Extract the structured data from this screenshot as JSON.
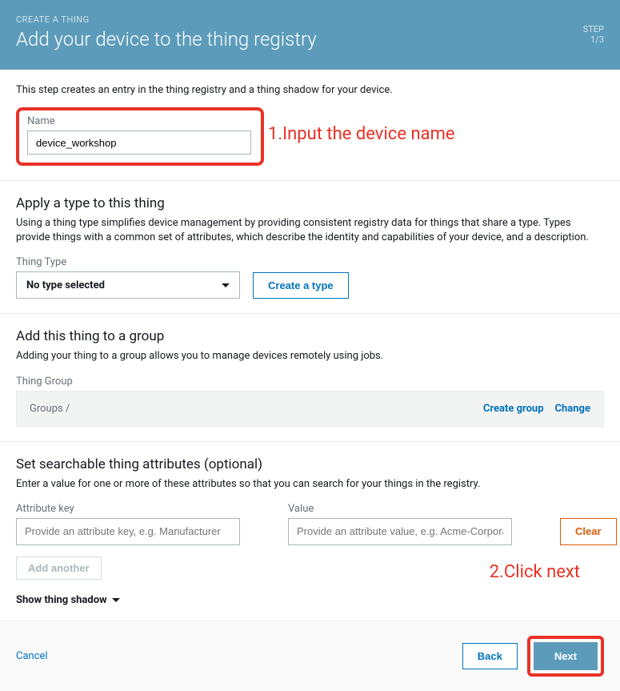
{
  "header": {
    "breadcrumb": "CREATE A THING",
    "title": "Add your device to the thing registry",
    "step_label": "STEP",
    "step_value": "1/3"
  },
  "intro": "This step creates an entry in the thing registry and a thing shadow for your device.",
  "name_field": {
    "label": "Name",
    "value": "device_workshop"
  },
  "annotations": {
    "a1": "1.Input the device name",
    "a2": "2.Click next"
  },
  "type_section": {
    "title": "Apply a type to this thing",
    "desc": "Using a thing type simplifies device management by providing consistent registry data for things that share a type. Types provide things with a common set of attributes, which describe the identity and capabilities of your device, and a description.",
    "label": "Thing Type",
    "selected": "No type selected",
    "create_btn": "Create a type"
  },
  "group_section": {
    "title": "Add this thing to a group",
    "desc": "Adding your thing to a group allows you to manage devices remotely using jobs.",
    "label": "Thing Group",
    "breadcrumb": "Groups /",
    "create_link": "Create group",
    "change_link": "Change"
  },
  "attr_section": {
    "title": "Set searchable thing attributes (optional)",
    "desc": "Enter a value for one or more of these attributes so that you can search for your things in the registry.",
    "key_label": "Attribute key",
    "key_placeholder": "Provide an attribute key, e.g. Manufacturer",
    "value_label": "Value",
    "value_placeholder": "Provide an attribute value, e.g. Acme-Corporation",
    "clear_btn": "Clear",
    "add_btn": "Add another",
    "show_shadow": "Show thing shadow"
  },
  "footer": {
    "cancel": "Cancel",
    "back": "Back",
    "next": "Next"
  }
}
